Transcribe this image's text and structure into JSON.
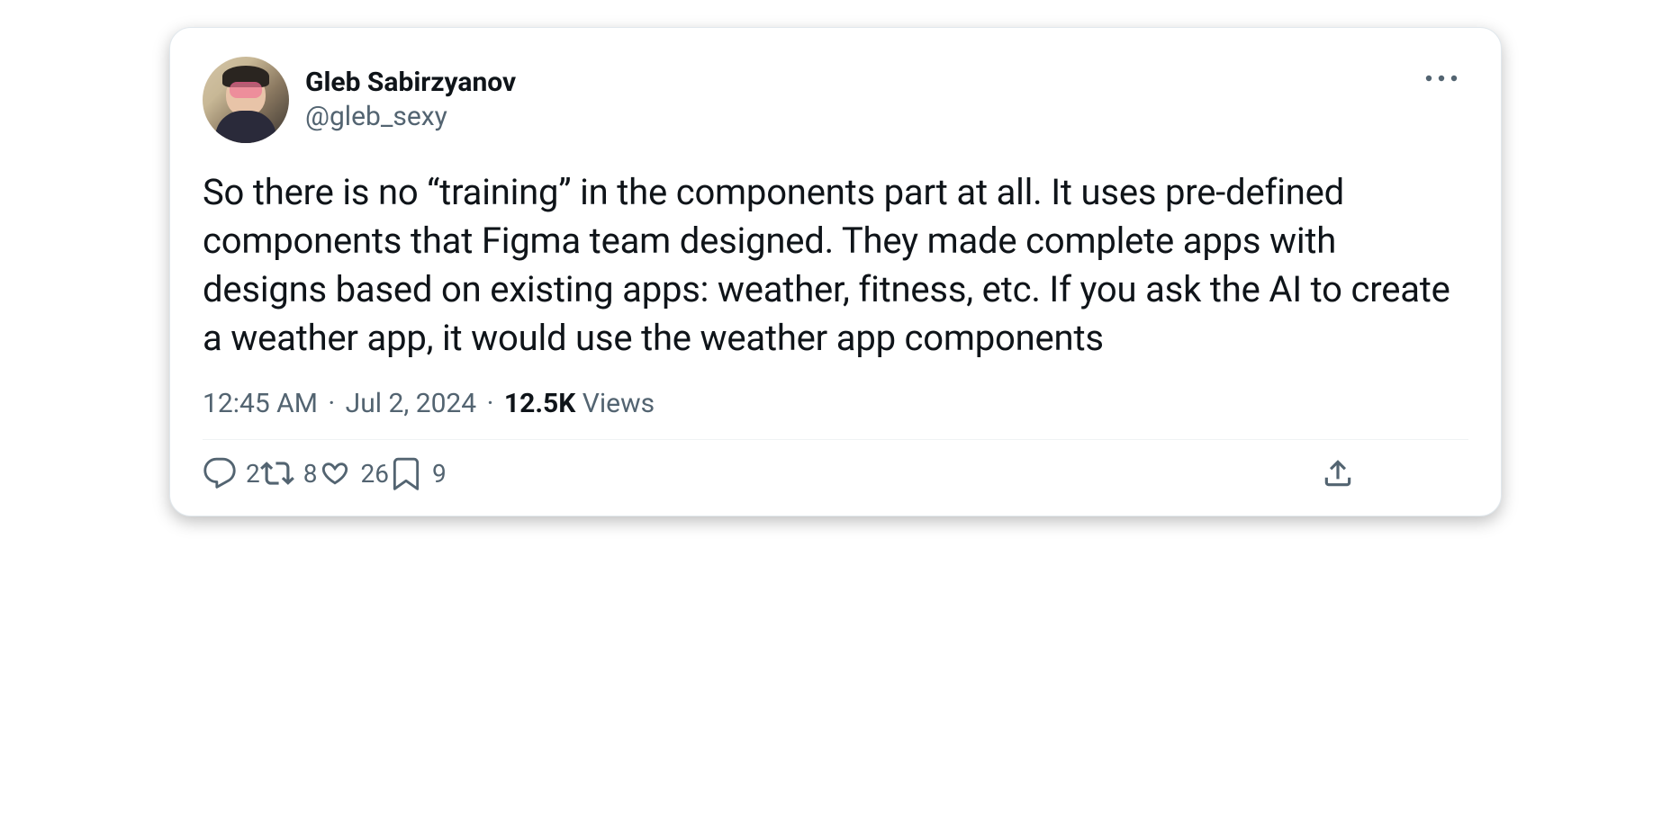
{
  "tweet": {
    "author": {
      "display_name": "Gleb Sabirzyanov",
      "handle": "@gleb_sexy"
    },
    "body": "So there is no “training” in the components part at all. It uses pre-defined components that Figma team designed. They made complete apps with designs based on existing apps: weather, fitness, etc. If you ask the AI to create a weather app, it would use the weather app components",
    "meta": {
      "time": "12:45 AM",
      "date": "Jul 2, 2024",
      "views_count": "12.5K",
      "views_label": "Views",
      "separator": "·"
    },
    "actions": {
      "replies": "2",
      "retweets": "8",
      "likes": "26",
      "bookmarks": "9"
    }
  }
}
